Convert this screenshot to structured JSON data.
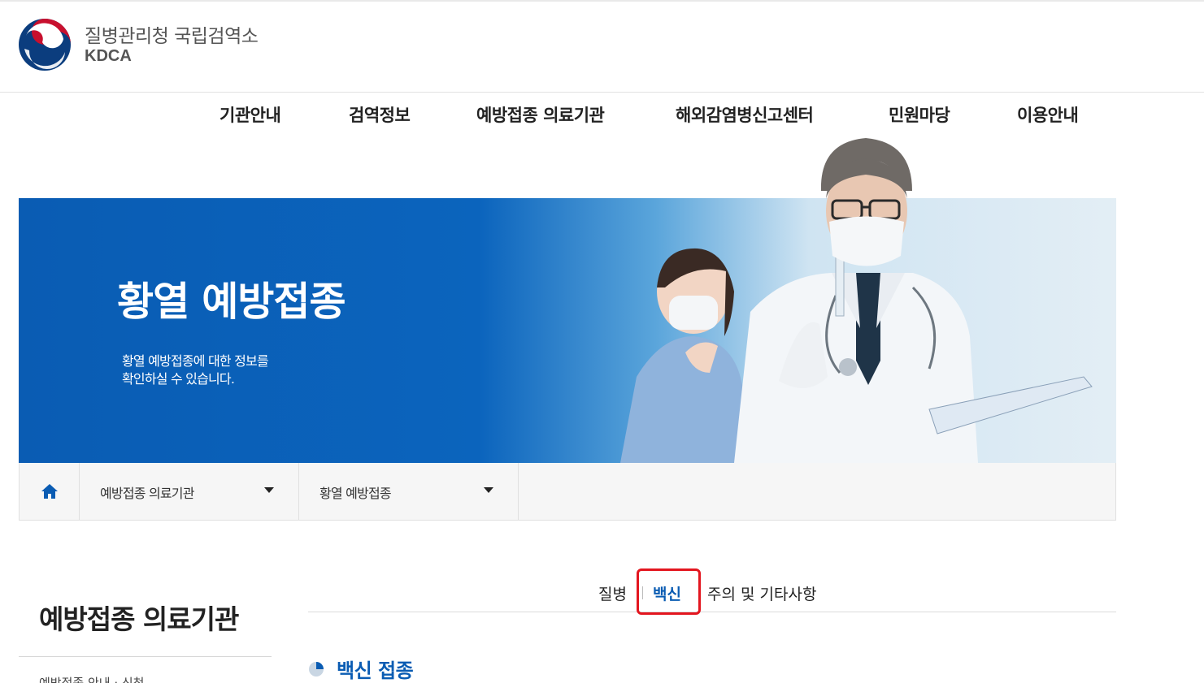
{
  "header": {
    "org_name_kr": "질병관리청 국립검역소",
    "org_name_en": "KDCA"
  },
  "gnb": {
    "items": [
      {
        "label": "기관안내"
      },
      {
        "label": "검역정보"
      },
      {
        "label": "예방접종 의료기관"
      },
      {
        "label": "해외감염병신고센터"
      },
      {
        "label": "민원마당"
      },
      {
        "label": "이용안내"
      }
    ]
  },
  "banner": {
    "title": "황열 예방접종",
    "desc_line1": "황열 예방접종에 대한 정보를",
    "desc_line2": "확인하실 수 있습니다."
  },
  "breadcrumb": {
    "home_icon": "home-icon",
    "level1": "예방접종 의료기관",
    "level2": "황열 예방접종"
  },
  "sidebar": {
    "title": "예방접종 의료기관",
    "first_item": "예방접종 안내 ‧ 신청"
  },
  "tabs": [
    {
      "label": "질병",
      "active": false
    },
    {
      "label": "백신",
      "active": true
    },
    {
      "label": "주의 및 기타사항",
      "active": false
    }
  ],
  "section": {
    "heading": "백신 접종"
  },
  "colors": {
    "brand_blue": "#0a5cb3",
    "highlight_red": "#e3161f"
  }
}
